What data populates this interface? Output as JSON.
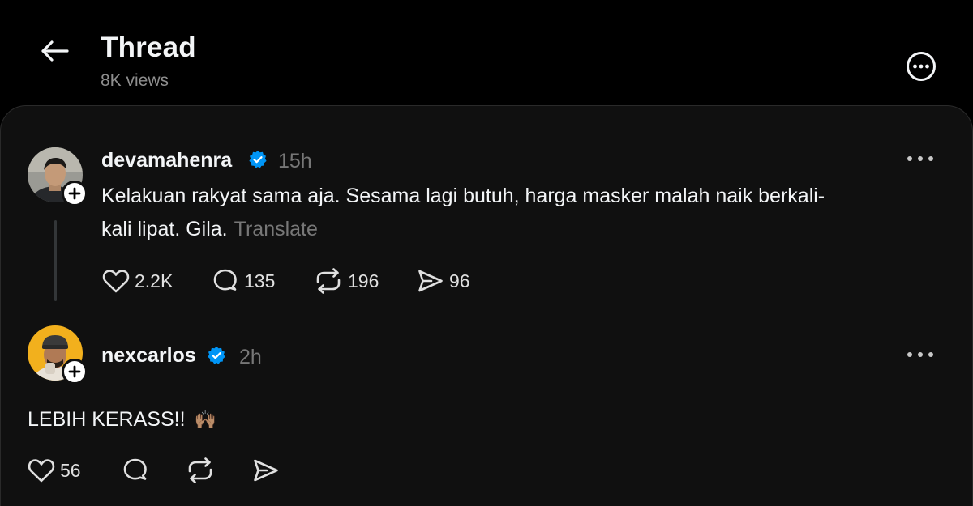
{
  "header": {
    "title": "Thread",
    "views": "8K views"
  },
  "post": {
    "username": "devamahenra",
    "time": "15h",
    "text_line1": "Kelakuan rakyat sama aja. Sesama lagi butuh, harga masker malah naik berkali-",
    "text_line2": "kali lipat. Gila.",
    "translate": "Translate",
    "likes": "2.2K",
    "replies": "135",
    "reposts": "196",
    "shares": "96"
  },
  "reply": {
    "username": "nexcarlos",
    "time": "2h",
    "text": "LEBIH KERASS!!",
    "emoji": "🙌🏽",
    "likes": "56"
  },
  "colors": {
    "background": "#000000",
    "card": "#101010",
    "verified": "#0095f6",
    "muted": "#777777"
  },
  "icons": [
    "back-arrow-icon",
    "more-circle-icon",
    "verified-badge-icon",
    "plus-icon",
    "more-dots-icon",
    "heart-icon",
    "comment-icon",
    "repost-icon",
    "share-icon"
  ]
}
